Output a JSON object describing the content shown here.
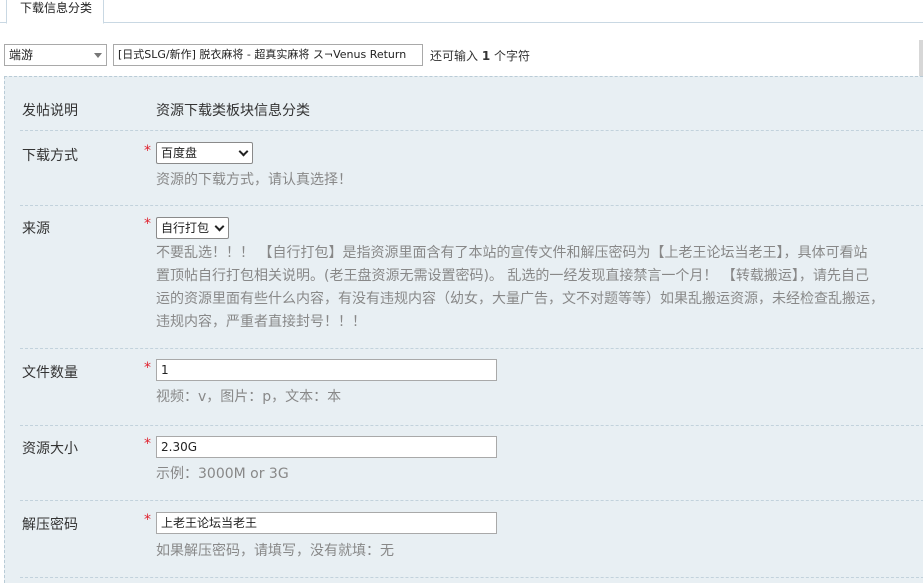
{
  "tab": {
    "label": "下载信息分类"
  },
  "toolbar": {
    "type_select": "端游",
    "title_value": "[日式SLG/新作] 脱衣麻将 - 超真实麻将 ス¬Venus Return",
    "remain_prefix": "还可输入",
    "remain_count": "1",
    "remain_suffix": "个字符"
  },
  "form": {
    "description": {
      "label": "发帖说明",
      "value": "资源下载类板块信息分类"
    },
    "download_method": {
      "label": "下载方式",
      "required": "*",
      "selected": "百度盘",
      "hint": "资源的下载方式，请认真选择！"
    },
    "source": {
      "label": "来源",
      "required": "*",
      "selected": "自行打包",
      "hint_lines": [
        "不要乱选！！！ 【自行打包】是指资源里面含有了本站的宣传文件和解压密码为【上老王论坛当老王】，具体可看站",
        "置顶帖自行打包相关说明。(老王盘资源无需设置密码)。 乱选的一经发现直接禁言一个月！ 【转载搬运】，请先自己",
        "运的资源里面有些什么内容，有没有违规内容（幼女，大量广告，文不对题等等）如果乱搬运资源，未经检查乱搬运，",
        "违规内容，严重者直接封号！！！"
      ]
    },
    "file_count": {
      "label": "文件数量",
      "required": "*",
      "value": "1",
      "hint": "视频：v，图片：p，文本：本"
    },
    "resource_size": {
      "label": "资源大小",
      "required": "*",
      "value": "2.30G",
      "hint": "示例：3000M or 3G"
    },
    "password": {
      "label": "解压密码",
      "required": "*",
      "value": "上老王论坛当老王",
      "hint": "如果解压密码，请填写，没有就填：无"
    }
  }
}
